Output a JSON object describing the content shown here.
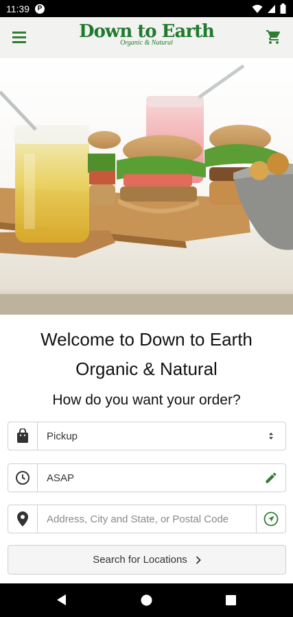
{
  "status_bar": {
    "time": "11:39",
    "app_badge": "P"
  },
  "header": {
    "brand_name": "Down to Earth",
    "brand_tagline": "Organic & Natural"
  },
  "hero": {
    "icon": "food-photo"
  },
  "welcome": {
    "line1": "Welcome to Down to Earth",
    "line2": "Organic & Natural"
  },
  "order": {
    "question": "How do you want your order?",
    "method": {
      "selected": "Pickup"
    },
    "time": {
      "value": "ASAP"
    },
    "address": {
      "placeholder": "Address, City and State, or Postal Code"
    },
    "search_label": "Search for Locations"
  },
  "colors": {
    "brand_green": "#1f7a2e",
    "icon_green": "#2e7d32"
  }
}
